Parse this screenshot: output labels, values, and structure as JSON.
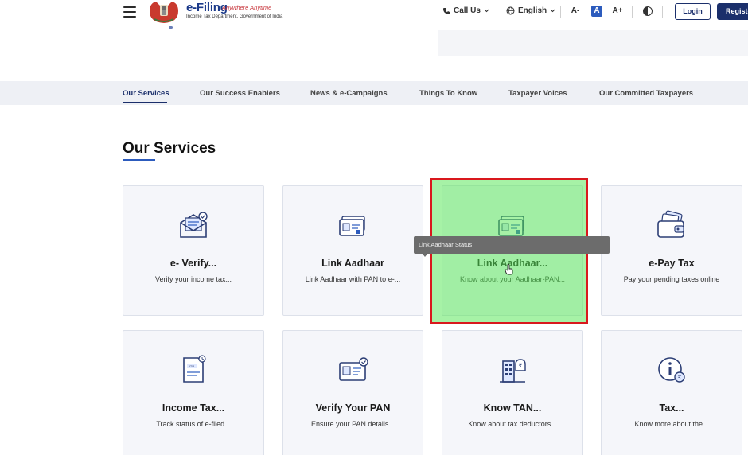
{
  "header": {
    "logo_title": "e-Filing",
    "logo_tagline": "Anywhere Anytime",
    "logo_subtitle": "Income Tax Department, Government of India",
    "call_us": "Call Us",
    "language": "English",
    "font_decrease": "A-",
    "font_normal": "A",
    "font_increase": "A+",
    "login": "Login",
    "register": "Registe"
  },
  "tabs": [
    {
      "label": "Our Services"
    },
    {
      "label": "Our Success Enablers"
    },
    {
      "label": "News & e-Campaigns"
    },
    {
      "label": "Things To Know"
    },
    {
      "label": "Taxpayer Voices"
    },
    {
      "label": "Our Committed Taxpayers"
    }
  ],
  "section": {
    "title": "Our Services"
  },
  "cards": [
    {
      "title": "e- Verify...",
      "desc": "Verify your income tax...",
      "icon": "envelope-check-icon"
    },
    {
      "title": "Link Aadhaar",
      "desc": "Link Aadhaar with PAN to e-...",
      "icon": "id-cards-icon"
    },
    {
      "title": "Link Aadhaar...",
      "desc": "Know about your Aadhaar-PAN...",
      "icon": "id-cards-icon"
    },
    {
      "title": "e-Pay Tax",
      "desc": "Pay your pending taxes online",
      "icon": "wallet-cards-icon"
    },
    {
      "title": "Income Tax...",
      "desc": "Track status of e-filed...",
      "icon": "itr-document-clock-icon"
    },
    {
      "title": "Verify Your PAN",
      "desc": "Ensure your PAN details...",
      "icon": "pan-card-check-icon"
    },
    {
      "title": "Know TAN...",
      "desc": "Know about tax deductors...",
      "icon": "building-money-icon"
    },
    {
      "title": "Tax...",
      "desc": "Know more about the...",
      "icon": "info-rupee-icon"
    }
  ],
  "tooltip": "Link Aadhaar Status",
  "colors": {
    "primary": "#1b2f6b",
    "accent": "#2c5bbd",
    "highlight": "#55e655",
    "highlight_border": "#d9181d"
  }
}
